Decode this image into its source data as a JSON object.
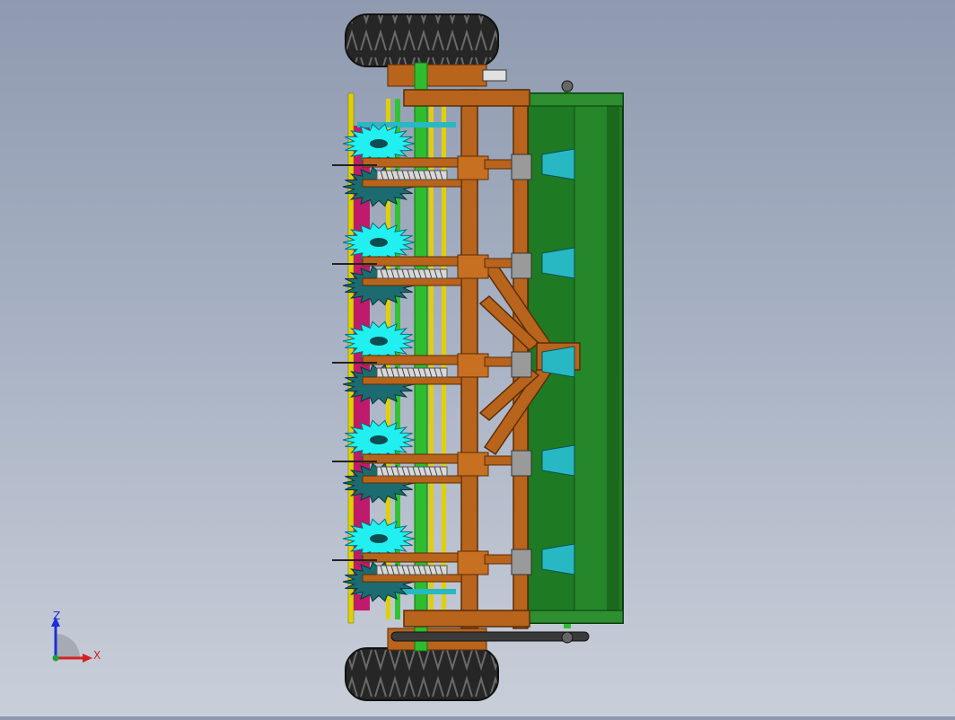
{
  "viewport": {
    "model_view": "seeder-planter-assembly-top-view",
    "row_units": 5
  },
  "triad": {
    "z_label": "Z",
    "x_label": "X",
    "colors": {
      "z_axis": "#1d2fd6",
      "x_axis": "#d62020",
      "origin": "#1aa23a",
      "quadrant": "#a6aab3"
    }
  },
  "colors": {
    "frame": "#b8641c",
    "frame_dark": "#7a3d0c",
    "hopper": "#1f7a24",
    "hopper_dark": "#0f4d13",
    "shaft": "#2ebd2e",
    "disc": "#27b8c4",
    "disc_light": "#22f0f0",
    "magenta": "#c01a6a",
    "yellow": "#e0d000",
    "tire": "#2b2b2b"
  }
}
